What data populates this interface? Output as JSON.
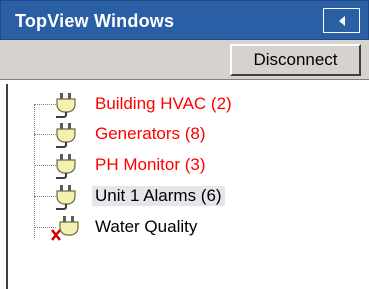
{
  "panel": {
    "title": "TopView Windows",
    "collapse_icon": "triangle-left-icon"
  },
  "toolbar": {
    "disconnect_label": "Disconnect"
  },
  "tree": {
    "items": [
      {
        "label": "Building HVAC (2)",
        "state": "alarm",
        "color": "#ff0000",
        "icon": "plug-icon"
      },
      {
        "label": "Generators (8)",
        "state": "alarm",
        "color": "#ff0000",
        "icon": "plug-icon"
      },
      {
        "label": "PH Monitor (3)",
        "state": "alarm",
        "color": "#ff0000",
        "icon": "plug-icon"
      },
      {
        "label": "Unit 1 Alarms (6)",
        "state": "selected",
        "color": "#000000",
        "icon": "plug-icon"
      },
      {
        "label": "Water Quality",
        "state": "disconnected",
        "color": "#000000",
        "icon": "plug-disconnected-icon"
      }
    ]
  },
  "colors": {
    "title_bar": "#2a5fa6",
    "alarm": "#ff0000"
  }
}
